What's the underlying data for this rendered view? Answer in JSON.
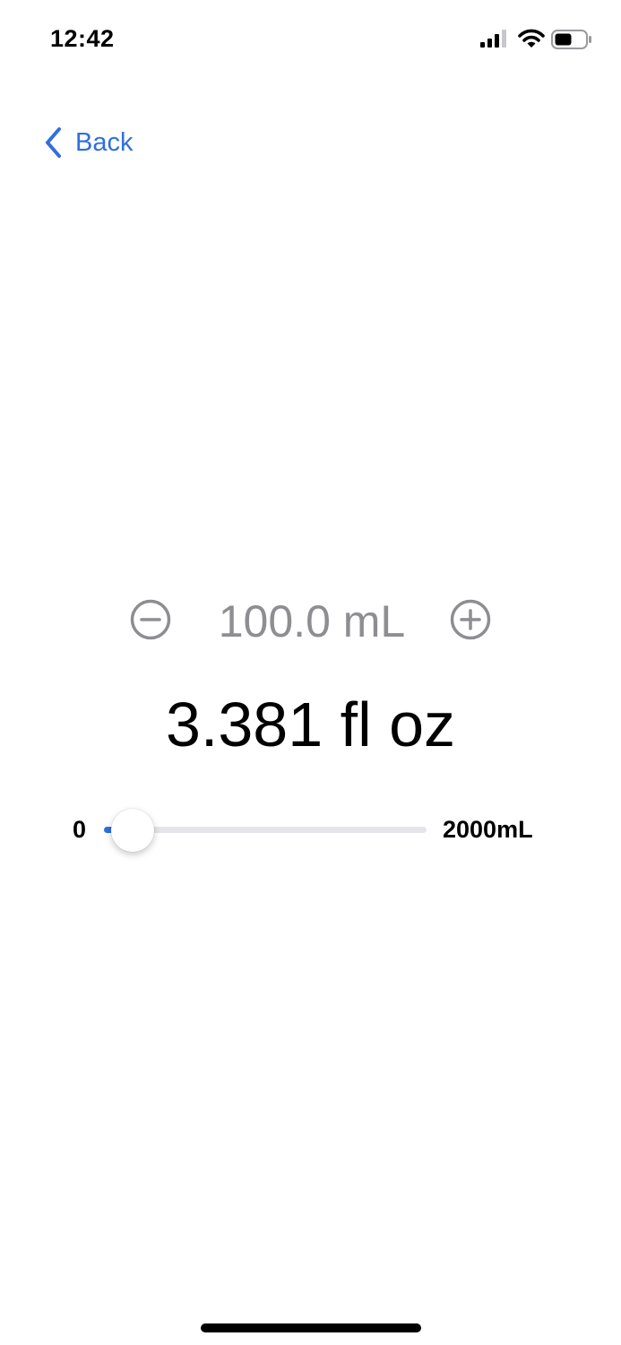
{
  "status_bar": {
    "time": "12:42",
    "icons": [
      "signal-icon",
      "wifi-icon",
      "battery-icon"
    ]
  },
  "nav": {
    "back_label": "Back",
    "back_icon": "chevron-left-icon"
  },
  "stepper": {
    "value": "100.0 mL",
    "decrement_icon": "minus-circle-icon",
    "increment_icon": "plus-circle-icon"
  },
  "result": {
    "value": "3.381 fl oz"
  },
  "slider": {
    "min_label": "0",
    "max_label": "2000mL",
    "min": 0,
    "max": 2000,
    "value": 100
  },
  "colors": {
    "accent": "#2f6fe0",
    "secondary_text": "#8e8e92",
    "track": "#e5e5ea"
  }
}
